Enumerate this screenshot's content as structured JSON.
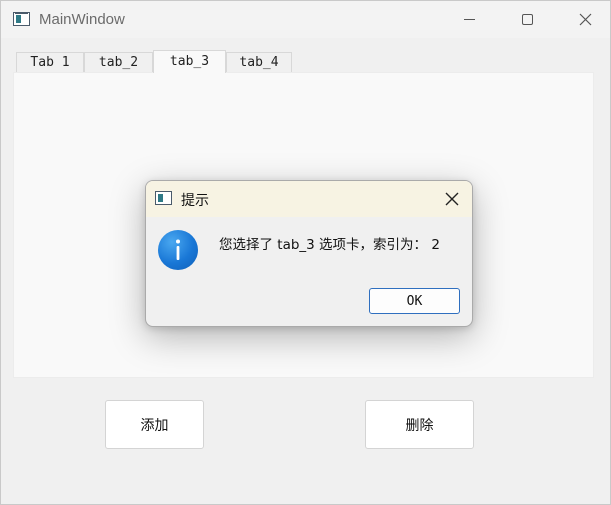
{
  "window": {
    "title": "MainWindow"
  },
  "tabs": [
    {
      "label": "Tab 1",
      "active": false
    },
    {
      "label": "tab_2",
      "active": false
    },
    {
      "label": "tab_3",
      "active": true
    },
    {
      "label": "tab_4",
      "active": false
    }
  ],
  "buttons": {
    "add_label": "添加",
    "delete_label": "删除"
  },
  "dialog": {
    "title": "提示",
    "message": "您选择了 tab_3 选项卡，索引为： 2",
    "ok_label": "OK"
  },
  "colors": {
    "info_icon": "#1977d6",
    "ok_border": "#2f6fbf",
    "dialog_titlebar": "#f7f3e3"
  },
  "icons": {
    "app": "app-window-icon",
    "minimize": "minimize-icon",
    "maximize": "maximize-icon",
    "close": "close-icon",
    "info": "info-icon"
  }
}
